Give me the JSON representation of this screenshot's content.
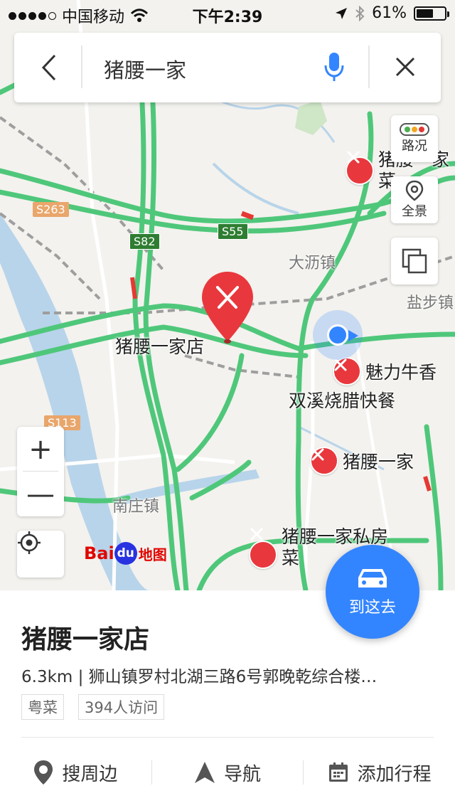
{
  "status_bar": {
    "carrier": "中国移动",
    "time": "下午2:39",
    "battery": "61%",
    "battery_level": 0.61
  },
  "search": {
    "query": "猪腰一家",
    "back_icon": "chevron-left-icon",
    "mic_icon": "microphone-icon",
    "close_icon": "close-icon"
  },
  "map_controls": {
    "traffic_label": "路况",
    "overview_label": "全景",
    "zoom_in": "+",
    "zoom_out": "—"
  },
  "map": {
    "labels": [
      "大沥镇",
      "盐步镇",
      "南庄镇"
    ],
    "shields": [
      "S263",
      "S82",
      "S55",
      "S113"
    ],
    "selected_pin_label": "猪腰一家店",
    "pois": [
      {
        "name": "猪腰一家",
        "extra": "菜"
      },
      {
        "name": "魅力牛香"
      },
      {
        "name": "双溪烧腊快餐"
      },
      {
        "name": "猪腰一家"
      },
      {
        "name": "猪腰一家私房",
        "extra": "菜"
      }
    ],
    "logo_text": "地图",
    "logo_brand": "Bai",
    "logo_du": "du"
  },
  "colors": {
    "accent": "#3385ff",
    "poi": "#e8383d",
    "road": "#4fc77a"
  },
  "goto_button": {
    "label": "到这去",
    "icon": "car-icon"
  },
  "place": {
    "title": "猪腰一家店",
    "info": "6.3km  |  狮山镇罗村北湖三路6号郭晚乾综合楼…",
    "tags": [
      "粤菜",
      "394人访问"
    ]
  },
  "actions": [
    {
      "label": "搜周边",
      "icon": "nearby-pin-icon"
    },
    {
      "label": "导航",
      "icon": "navigation-arrow-icon"
    },
    {
      "label": "添加行程",
      "icon": "calendar-icon"
    }
  ]
}
